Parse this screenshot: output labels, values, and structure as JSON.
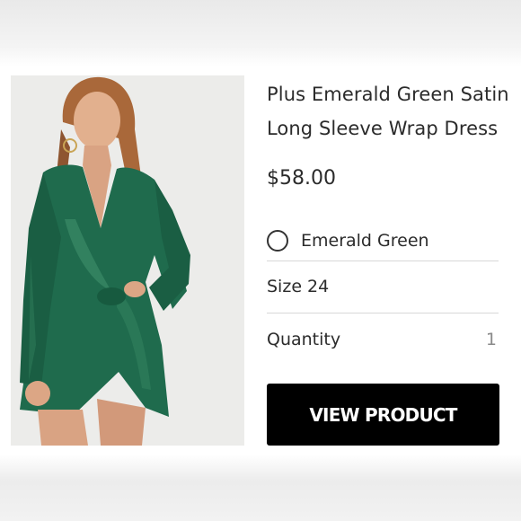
{
  "product": {
    "title_line1": "Plus Emerald Green Satin",
    "title_line2": "Long Sleeve Wrap Dress",
    "price": "$58.00",
    "image_icon": "dress-photo",
    "colors": {
      "accent": "#1f6b4d",
      "button": "#000000"
    }
  },
  "options": {
    "color_label": "Emerald Green",
    "size_label": "Size 24",
    "quantity_label": "Quantity",
    "quantity_value": "1"
  },
  "actions": {
    "view_product_label": "VIEW PRODUCT"
  }
}
